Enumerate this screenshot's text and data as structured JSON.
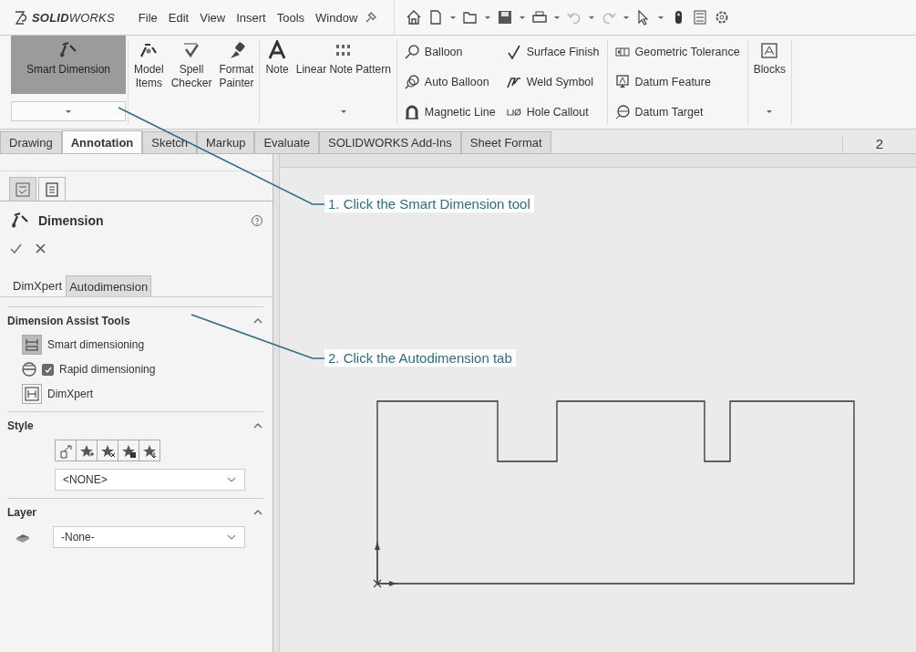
{
  "app": {
    "logo": "**SOLID**WORKS"
  },
  "menu": [
    "File",
    "Edit",
    "View",
    "Insert",
    "Tools",
    "Window"
  ],
  "ribbon": {
    "large_tools": [
      {
        "kind": "smart-dimension",
        "label": "Smart Dimension",
        "selected": true,
        "has_menu": true
      },
      {
        "kind": "model-items",
        "label": "Model\nItems",
        "selected": false,
        "has_menu": false
      },
      {
        "kind": "spell",
        "label": "Spell\nChecker",
        "selected": false,
        "has_menu": false
      },
      {
        "kind": "painter",
        "label": "Format\nPainter",
        "selected": false,
        "has_menu": false
      },
      {
        "kind": "note",
        "label": "Note",
        "selected": false,
        "has_menu": false
      },
      {
        "kind": "note-pattern",
        "label": "Linear Note Pattern",
        "selected": false,
        "has_menu": true
      }
    ],
    "small_columns": [
      [
        {
          "kind": "balloon",
          "label": "Balloon"
        },
        {
          "kind": "auto-balloon",
          "label": "Auto Balloon"
        },
        {
          "kind": "magnet",
          "label": "Magnetic Line"
        }
      ],
      [
        {
          "kind": "surface-finish",
          "label": "Surface Finish"
        },
        {
          "kind": "weld",
          "label": "Weld Symbol"
        },
        {
          "kind": "hole",
          "label": "Hole Callout"
        }
      ],
      [
        {
          "kind": "gtol",
          "label": "Geometric Tolerance"
        },
        {
          "kind": "datum-feature",
          "label": "Datum Feature"
        },
        {
          "kind": "datum-target",
          "label": "Datum Target"
        }
      ]
    ],
    "blocks": {
      "label": "Blocks",
      "has_menu": true
    }
  },
  "tabs": [
    {
      "label": "Drawing",
      "selected": false
    },
    {
      "label": "Annotation",
      "selected": true
    },
    {
      "label": "Sketch",
      "selected": false
    },
    {
      "label": "Markup",
      "selected": false
    },
    {
      "label": "Evaluate",
      "selected": false
    },
    {
      "label": "SOLIDWORKS Add-Ins",
      "selected": false
    },
    {
      "label": "Sheet Format",
      "selected": false
    }
  ],
  "sheet": {
    "zone_label": "2"
  },
  "property_manager": {
    "view_tabs": [
      {
        "kind": "drawing-tree",
        "selected": false
      },
      {
        "kind": "property",
        "selected": true
      }
    ],
    "title": "Dimension",
    "tabs": [
      {
        "label": "DimXpert",
        "selected": true
      },
      {
        "label": "Autodimension",
        "selected": false
      }
    ],
    "assist_tools": {
      "title": "Dimension Assist Tools",
      "expanded": true,
      "items": [
        {
          "kind": "button",
          "label": "Smart dimensioning",
          "pressed": true
        },
        {
          "kind": "checkbox",
          "label": "Rapid dimensioning",
          "checked": true
        },
        {
          "kind": "button",
          "label": "DimXpert",
          "pressed": false
        }
      ]
    },
    "style": {
      "title": "Style",
      "expanded": true,
      "value": "<NONE>"
    },
    "layer": {
      "title": "Layer",
      "expanded": true,
      "value": "-None-"
    }
  },
  "callouts": [
    {
      "text": "1. Click the Smart Dimension tool"
    },
    {
      "text": "2. Click the Autodimension tab"
    }
  ]
}
